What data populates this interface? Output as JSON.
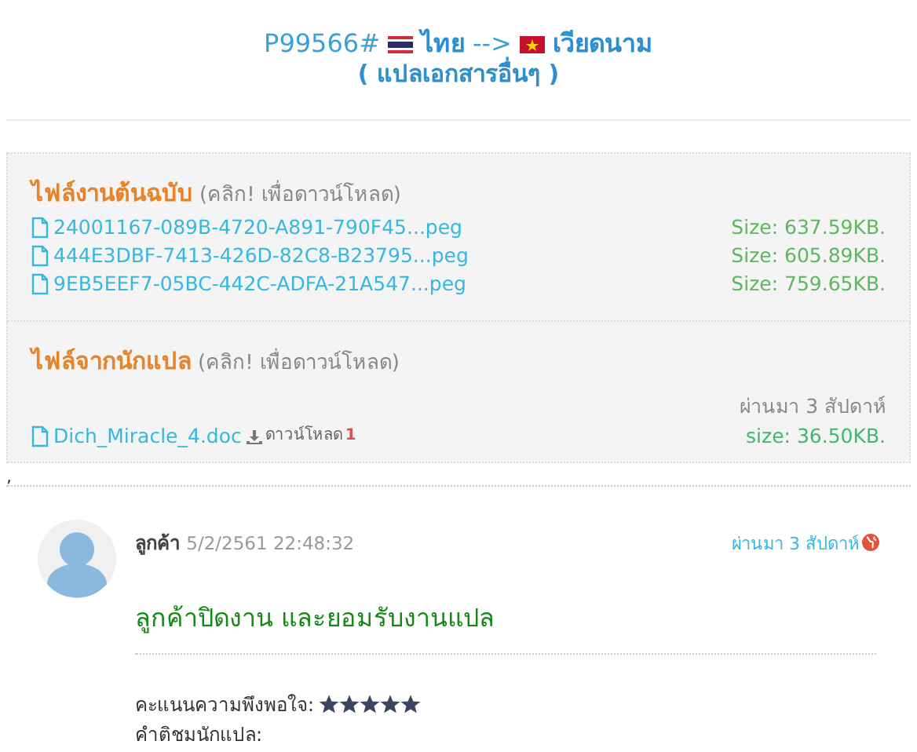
{
  "header": {
    "order_id": "P99566#",
    "source_language": "ไทย",
    "arrow": "-->",
    "target_language": "เวียดนาม",
    "subtitle": "( แปลเอกสารอื่นๆ )"
  },
  "original_files": {
    "title": "ไฟล์งานต้นฉบับ",
    "hint": "(คลิก! เพื่อดาวน์โหลด)",
    "files": [
      {
        "name": "24001167-089B-4720-A891-790F45...peg",
        "size": "Size: 637.59KB."
      },
      {
        "name": "444E3DBF-7413-426D-82C8-B23795...peg",
        "size": "Size: 605.89KB."
      },
      {
        "name": "9EB5EEF7-05BC-442C-ADFA-21A547...peg",
        "size": "Size: 759.65KB."
      }
    ]
  },
  "translator_files": {
    "title": "ไฟล์จากนักแปล",
    "hint": "(คลิก! เพื่อดาวน์โหลด)",
    "files": [
      {
        "name": "Dich_Miracle_4.doc",
        "download_label": "ดาวน์โหลด",
        "download_count": "1",
        "age": "ผ่านมา 3 สัปดาห์",
        "size": "size: 36.50KB."
      }
    ]
  },
  "stray_mark": ",",
  "comment": {
    "author": "ลูกค้า",
    "date": "5/2/2561 22:48:32",
    "age": "ผ่านมา 3 สัปดาห์",
    "message": "ลูกค้าปิดงาน และยอมรับงานแปล",
    "rating_label": "คะแนนความพึงพอใจ:",
    "stars": 5,
    "feedback_label": "คำติชมนักแปล:"
  }
}
